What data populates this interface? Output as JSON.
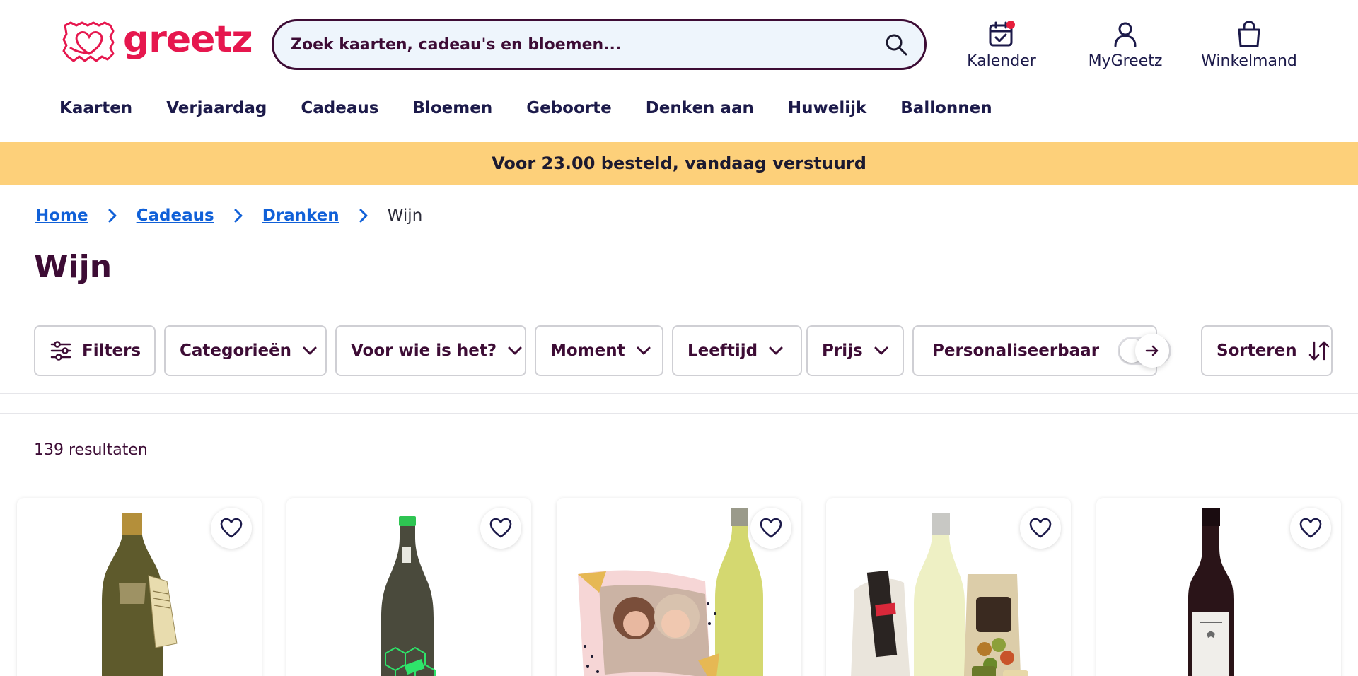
{
  "brand": {
    "name": "greetz",
    "color": "#e6174e",
    "dark": "#3d0c35",
    "link": "#1060d8"
  },
  "search": {
    "placeholder": "Zoek kaarten, cadeau's en bloemen..."
  },
  "header_icons": [
    {
      "icon": "calendar-icon",
      "label": "Kalender"
    },
    {
      "icon": "user-icon",
      "label": "MyGreetz"
    },
    {
      "icon": "shopping-bag-icon",
      "label": "Winkelmand"
    }
  ],
  "nav": [
    "Kaarten",
    "Verjaardag",
    "Cadeaus",
    "Bloemen",
    "Geboorte",
    "Denken aan",
    "Huwelijk",
    "Ballonnen"
  ],
  "banner": {
    "text": "Voor 23.00 besteld, vandaag verstuurd",
    "color": "#fdd07a"
  },
  "breadcrumb": {
    "items": [
      "Home",
      "Cadeaus",
      "Dranken"
    ],
    "current": "Wijn"
  },
  "page": {
    "title": "Wijn"
  },
  "filters": {
    "filters_label": "Filters",
    "dropdowns": [
      "Categorieën",
      "Voor wie is het?",
      "Moment",
      "Leeftijd",
      "Prijs"
    ],
    "toggle_label": "Personaliseerbaar",
    "toggle_on": false,
    "sort_label": "Sorteren"
  },
  "results": {
    "text": "139 resultaten"
  },
  "products": [
    {
      "icon": "heart-icon",
      "image": "sparkling-wine-bottle"
    },
    {
      "icon": "heart-icon",
      "image": "white-wine-bottle-green-label"
    },
    {
      "icon": "heart-icon",
      "image": "photo-card-with-white-wine"
    },
    {
      "icon": "heart-icon",
      "image": "wine-gift-package-nuts-crostini"
    },
    {
      "icon": "heart-icon",
      "image": "red-wine-bottle"
    }
  ]
}
